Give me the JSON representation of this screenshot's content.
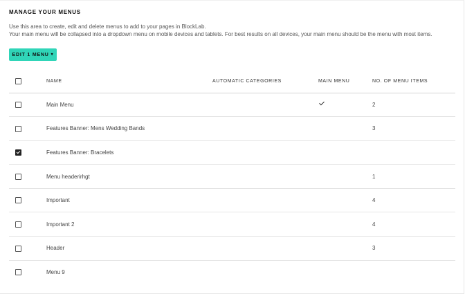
{
  "heading": "MANAGE YOUR MENUS",
  "description": [
    "Use this area to create, edit and delete menus to add to your pages in BlockLab.",
    "Your main menu will be collapsed into a dropdown menu on mobile devices and tablets. For best results on all devices, your main menu should be the menu with most items."
  ],
  "edit_button": {
    "label": "EDIT 1 MENU",
    "icon": "caret-down-icon",
    "color": "#30d5b8"
  },
  "table": {
    "select_all_checked": false,
    "columns": [
      "NAME",
      "AUTOMATIC CATEGORIES",
      "MAIN MENU",
      "NO. OF MENU ITEMS"
    ],
    "rows": [
      {
        "checked": false,
        "name": "Main Menu",
        "automatic_categories": "",
        "main_menu": true,
        "menu_items": "2"
      },
      {
        "checked": false,
        "name": "Features Banner: Mens Wedding Bands",
        "automatic_categories": "",
        "main_menu": false,
        "menu_items": "3"
      },
      {
        "checked": true,
        "name": "Features Banner: Bracelets",
        "automatic_categories": "",
        "main_menu": false,
        "menu_items": ""
      },
      {
        "checked": false,
        "name": "Menu headerirhgt",
        "automatic_categories": "",
        "main_menu": false,
        "menu_items": "1"
      },
      {
        "checked": false,
        "name": "Important",
        "automatic_categories": "",
        "main_menu": false,
        "menu_items": "4"
      },
      {
        "checked": false,
        "name": "Important 2",
        "automatic_categories": "",
        "main_menu": false,
        "menu_items": "4"
      },
      {
        "checked": false,
        "name": "Header",
        "automatic_categories": "",
        "main_menu": false,
        "menu_items": "3"
      },
      {
        "checked": false,
        "name": "Menu 9",
        "automatic_categories": "",
        "main_menu": false,
        "menu_items": ""
      }
    ]
  }
}
